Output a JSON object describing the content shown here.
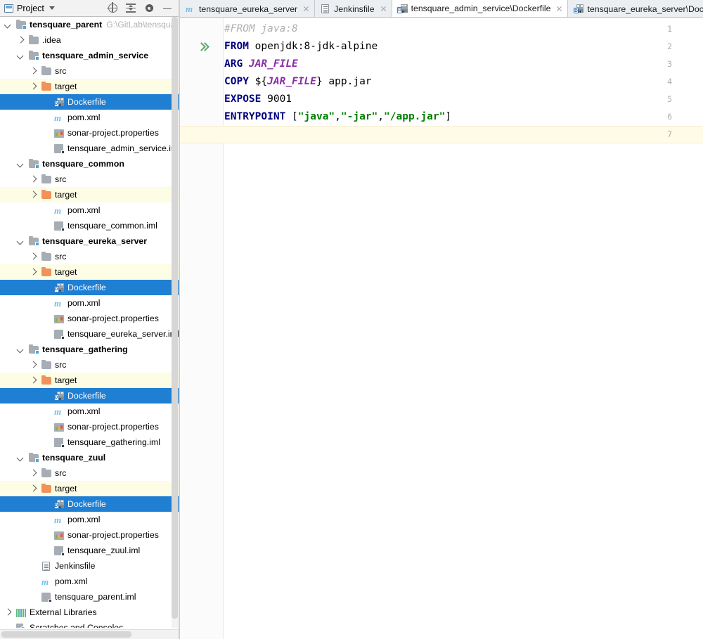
{
  "panel": {
    "title": "Project",
    "icon": "project-icon",
    "dropdown_icon": "chevron-down-icon",
    "tools": [
      {
        "name": "locate-icon",
        "label": "Select Opened File"
      },
      {
        "name": "collapse-all-icon",
        "label": "Collapse All"
      },
      {
        "name": "gear-icon",
        "label": "Settings"
      },
      {
        "name": "minimize-icon",
        "label": "Hide"
      }
    ]
  },
  "tree": {
    "rows": [
      {
        "indent": 0,
        "arrow": "down",
        "icon": "module-folder-icon",
        "label": "tensquare_parent",
        "bold": true,
        "path": "G:\\GitLab\\tensquare_",
        "state": "normal"
      },
      {
        "indent": 1,
        "arrow": "right",
        "icon": "folder-icon",
        "label": ".idea",
        "state": "normal"
      },
      {
        "indent": 1,
        "arrow": "down",
        "icon": "module-folder-icon",
        "label": "tensquare_admin_service",
        "bold": true,
        "state": "normal"
      },
      {
        "indent": 2,
        "arrow": "right",
        "icon": "folder-icon",
        "label": "src",
        "state": "normal"
      },
      {
        "indent": 2,
        "arrow": "right",
        "icon": "target-folder-icon",
        "label": "target",
        "state": "excluded"
      },
      {
        "indent": 3,
        "arrow": "none",
        "icon": "dockerfile-icon",
        "label": "Dockerfile",
        "state": "selected"
      },
      {
        "indent": 3,
        "arrow": "none",
        "icon": "maven-icon",
        "label": "pom.xml",
        "state": "normal"
      },
      {
        "indent": 3,
        "arrow": "none",
        "icon": "properties-icon",
        "label": "sonar-project.properties",
        "state": "normal"
      },
      {
        "indent": 3,
        "arrow": "none",
        "icon": "iml-icon",
        "label": "tensquare_admin_service.iml",
        "state": "normal"
      },
      {
        "indent": 1,
        "arrow": "down",
        "icon": "module-folder-icon",
        "label": "tensquare_common",
        "bold": true,
        "state": "normal"
      },
      {
        "indent": 2,
        "arrow": "right",
        "icon": "folder-icon",
        "label": "src",
        "state": "normal"
      },
      {
        "indent": 2,
        "arrow": "right",
        "icon": "target-folder-icon",
        "label": "target",
        "state": "excluded"
      },
      {
        "indent": 3,
        "arrow": "none",
        "icon": "maven-icon",
        "label": "pom.xml",
        "state": "normal"
      },
      {
        "indent": 3,
        "arrow": "none",
        "icon": "iml-icon",
        "label": "tensquare_common.iml",
        "state": "normal"
      },
      {
        "indent": 1,
        "arrow": "down",
        "icon": "module-folder-icon",
        "label": "tensquare_eureka_server",
        "bold": true,
        "state": "normal"
      },
      {
        "indent": 2,
        "arrow": "right",
        "icon": "folder-icon",
        "label": "src",
        "state": "normal"
      },
      {
        "indent": 2,
        "arrow": "right",
        "icon": "target-folder-icon",
        "label": "target",
        "state": "excluded"
      },
      {
        "indent": 3,
        "arrow": "none",
        "icon": "dockerfile-icon",
        "label": "Dockerfile",
        "state": "selected"
      },
      {
        "indent": 3,
        "arrow": "none",
        "icon": "maven-icon",
        "label": "pom.xml",
        "state": "normal"
      },
      {
        "indent": 3,
        "arrow": "none",
        "icon": "properties-icon",
        "label": "sonar-project.properties",
        "state": "normal"
      },
      {
        "indent": 3,
        "arrow": "none",
        "icon": "iml-icon",
        "label": "tensquare_eureka_server.iml",
        "state": "normal"
      },
      {
        "indent": 1,
        "arrow": "down",
        "icon": "module-folder-icon",
        "label": "tensquare_gathering",
        "bold": true,
        "state": "normal"
      },
      {
        "indent": 2,
        "arrow": "right",
        "icon": "folder-icon",
        "label": "src",
        "state": "normal"
      },
      {
        "indent": 2,
        "arrow": "right",
        "icon": "target-folder-icon",
        "label": "target",
        "state": "excluded"
      },
      {
        "indent": 3,
        "arrow": "none",
        "icon": "dockerfile-icon",
        "label": "Dockerfile",
        "state": "selected"
      },
      {
        "indent": 3,
        "arrow": "none",
        "icon": "maven-icon",
        "label": "pom.xml",
        "state": "normal"
      },
      {
        "indent": 3,
        "arrow": "none",
        "icon": "properties-icon",
        "label": "sonar-project.properties",
        "state": "normal"
      },
      {
        "indent": 3,
        "arrow": "none",
        "icon": "iml-icon",
        "label": "tensquare_gathering.iml",
        "state": "normal"
      },
      {
        "indent": 1,
        "arrow": "down",
        "icon": "module-folder-icon",
        "label": "tensquare_zuul",
        "bold": true,
        "state": "normal"
      },
      {
        "indent": 2,
        "arrow": "right",
        "icon": "folder-icon",
        "label": "src",
        "state": "normal"
      },
      {
        "indent": 2,
        "arrow": "right",
        "icon": "target-folder-icon",
        "label": "target",
        "state": "excluded"
      },
      {
        "indent": 3,
        "arrow": "none",
        "icon": "dockerfile-icon",
        "label": "Dockerfile",
        "state": "selected"
      },
      {
        "indent": 3,
        "arrow": "none",
        "icon": "maven-icon",
        "label": "pom.xml",
        "state": "normal"
      },
      {
        "indent": 3,
        "arrow": "none",
        "icon": "properties-icon",
        "label": "sonar-project.properties",
        "state": "normal"
      },
      {
        "indent": 3,
        "arrow": "none",
        "icon": "iml-icon",
        "label": "tensquare_zuul.iml",
        "state": "normal"
      },
      {
        "indent": 2,
        "arrow": "none",
        "icon": "document-icon",
        "label": "Jenkinsfile",
        "state": "normal"
      },
      {
        "indent": 2,
        "arrow": "none",
        "icon": "maven-icon",
        "label": "pom.xml",
        "state": "normal"
      },
      {
        "indent": 2,
        "arrow": "none",
        "icon": "iml-icon",
        "label": "tensquare_parent.iml",
        "state": "normal"
      },
      {
        "indent": 0,
        "arrow": "right",
        "icon": "external-libraries-icon",
        "label": "External Libraries",
        "state": "normal"
      },
      {
        "indent": 0,
        "arrow": "none",
        "icon": "scratches-icon",
        "label": "Scratches and Consoles",
        "state": "normal"
      }
    ]
  },
  "tabs": [
    {
      "label": "tensquare_eureka_server",
      "icon": "maven-icon",
      "active": false,
      "closable": true
    },
    {
      "label": "Jenkinsfile",
      "icon": "document-icon",
      "active": false,
      "closable": true
    },
    {
      "label": "tensquare_admin_service\\Dockerfile",
      "icon": "dockerfile-icon",
      "active": true,
      "closable": true
    },
    {
      "label": "tensquare_eureka_server\\Dockerfile",
      "icon": "dockerfile-icon",
      "active": false,
      "closable": false
    }
  ],
  "editor": {
    "caret_line": 7,
    "gutter_run_line": 2,
    "gutter_run_icon": "run-double-chevron-icon",
    "lines": [
      {
        "n": "1",
        "tokens": [
          {
            "t": "#FROM java:8",
            "c": "cmt"
          }
        ]
      },
      {
        "n": "2",
        "tokens": [
          {
            "t": "FROM",
            "c": "kw"
          },
          {
            "t": " openjdk:8-jdk-alpine",
            "c": "pln"
          }
        ]
      },
      {
        "n": "3",
        "tokens": [
          {
            "t": "ARG",
            "c": "kw"
          },
          {
            "t": " ",
            "c": "pln"
          },
          {
            "t": "JAR_FILE",
            "c": "var"
          }
        ]
      },
      {
        "n": "4",
        "tokens": [
          {
            "t": "COPY",
            "c": "kw"
          },
          {
            "t": " ${",
            "c": "pln"
          },
          {
            "t": "JAR_FILE",
            "c": "var"
          },
          {
            "t": "} app.jar",
            "c": "pln"
          }
        ]
      },
      {
        "n": "5",
        "tokens": [
          {
            "t": "EXPOSE",
            "c": "kw"
          },
          {
            "t": " 9001",
            "c": "pln"
          }
        ]
      },
      {
        "n": "6",
        "tokens": [
          {
            "t": "ENTRYPOINT",
            "c": "kw"
          },
          {
            "t": " [",
            "c": "brk"
          },
          {
            "t": "\"java\"",
            "c": "str"
          },
          {
            "t": ",",
            "c": "brk"
          },
          {
            "t": "\"-jar\"",
            "c": "str"
          },
          {
            "t": ",",
            "c": "brk"
          },
          {
            "t": "\"/app.jar\"",
            "c": "str"
          },
          {
            "t": "]",
            "c": "brk"
          }
        ]
      },
      {
        "n": "7",
        "tokens": []
      }
    ]
  },
  "colors": {
    "selection": "#1f7fd3",
    "excluded_row": "#fdfce4",
    "caret_line": "#fffbe6",
    "keyword": "#000080",
    "string": "#008000",
    "variable": "#8c2ba8",
    "comment": "#b0b0b0",
    "run_icon": "#59a869"
  }
}
